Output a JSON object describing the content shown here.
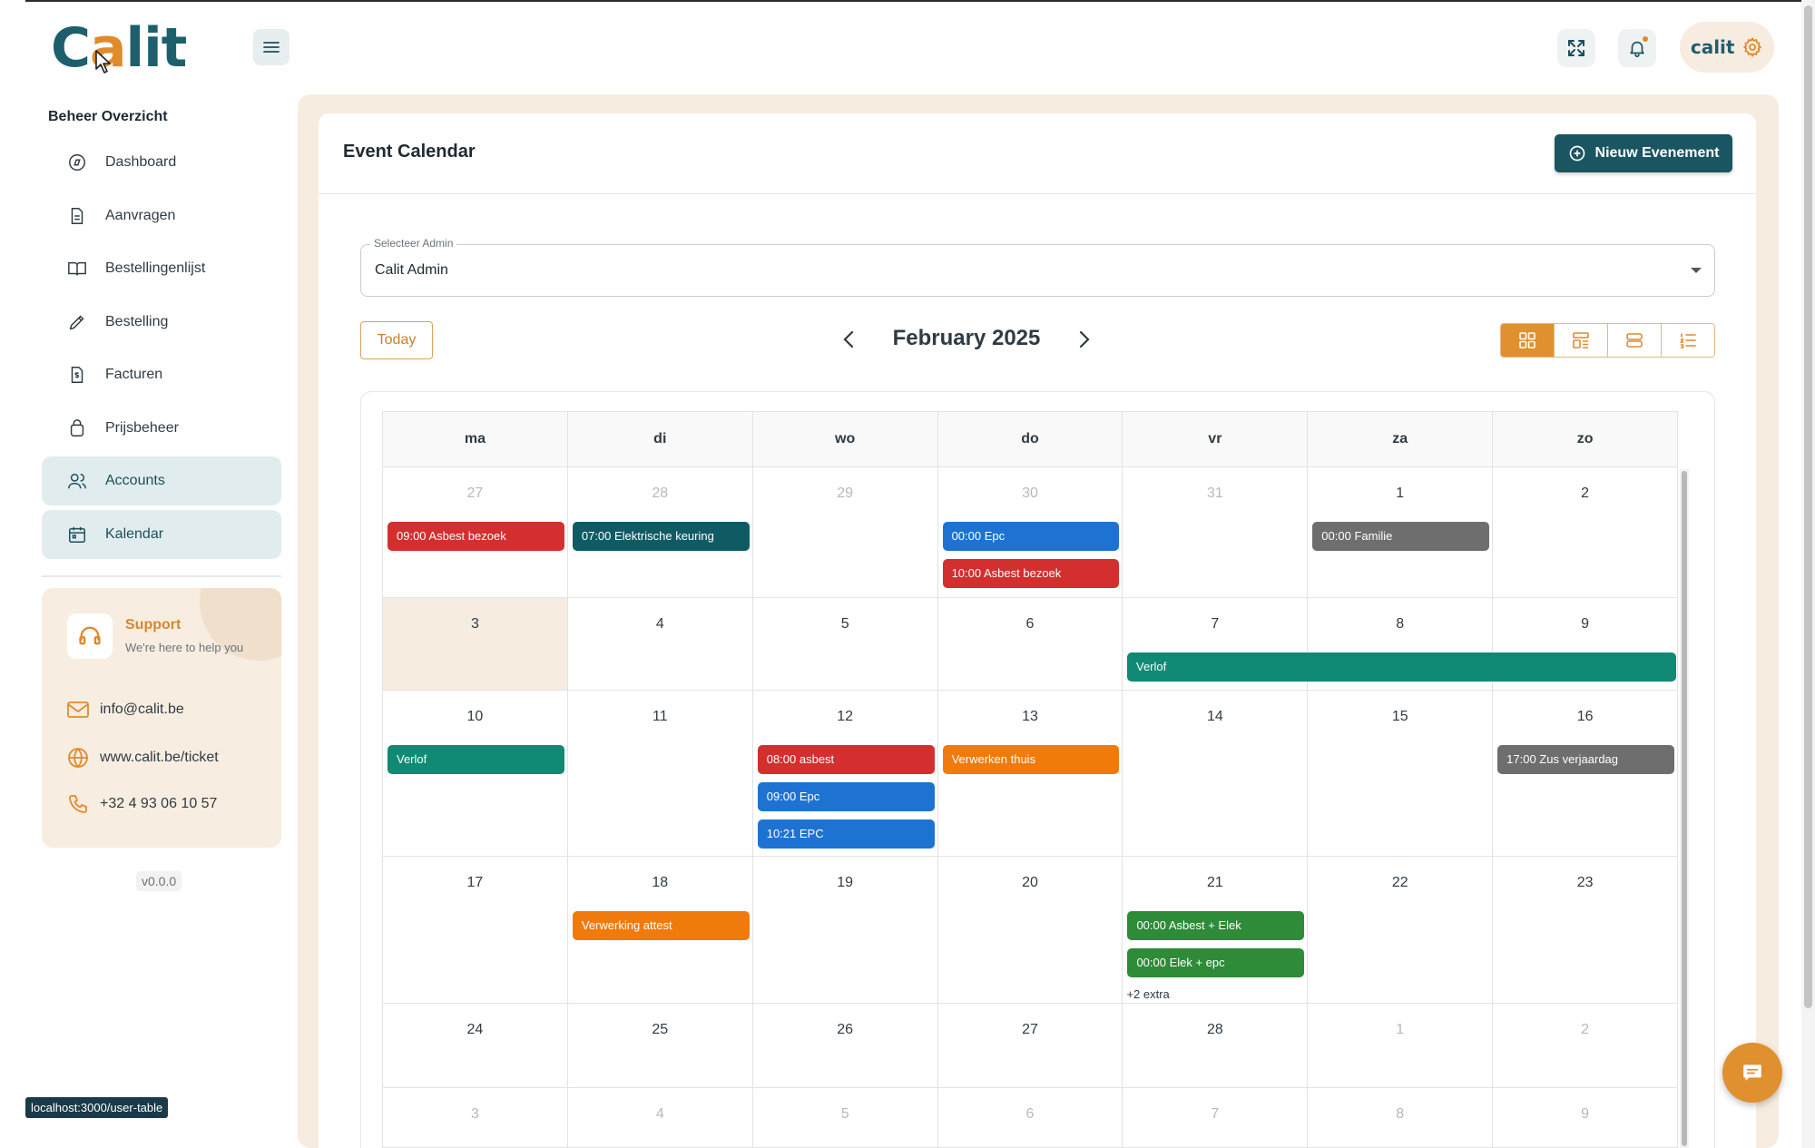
{
  "app": {
    "logo_main": "Calit",
    "logo_part1": "C",
    "logo_accent": "a",
    "logo_part2": "lit",
    "profile_mini": "calit"
  },
  "sidebar": {
    "section_title": "Beheer Overzicht",
    "items": [
      {
        "label": "Dashboard",
        "icon": "compass-icon",
        "active": false
      },
      {
        "label": "Aanvragen",
        "icon": "document-icon",
        "active": false
      },
      {
        "label": "Bestellingenlijst",
        "icon": "book-icon",
        "active": false
      },
      {
        "label": "Bestelling",
        "icon": "pencil-icon",
        "active": false
      },
      {
        "label": "Facturen",
        "icon": "invoice-icon",
        "active": false
      },
      {
        "label": "Prijsbeheer",
        "icon": "bag-icon",
        "active": false
      },
      {
        "label": "Accounts",
        "icon": "users-icon",
        "active": true
      },
      {
        "label": "Kalendar",
        "icon": "calendar-icon",
        "active": true
      }
    ],
    "support": {
      "title": "Support",
      "subtitle": "We're here to help you",
      "email": "info@calit.be",
      "website": "www.calit.be/ticket",
      "phone": "+32 4 93 06 10 57"
    },
    "version": "v0.0.0"
  },
  "main": {
    "title": "Event Calendar",
    "new_button": "Nieuw Evenement",
    "admin_select": {
      "label": "Selecteer Admin",
      "value": "Calit Admin"
    },
    "today_button": "Today",
    "month_label": "February 2025",
    "weekdays": [
      "ma",
      "di",
      "wo",
      "do",
      "vr",
      "za",
      "zo"
    ],
    "weeks": [
      {
        "days": [
          {
            "num": "27",
            "dim": true,
            "events": [
              {
                "text": "09:00 Asbest bezoek",
                "color": "red"
              }
            ]
          },
          {
            "num": "28",
            "dim": true,
            "events": [
              {
                "text": "07:00 Elektrische keuring",
                "color": "teal"
              }
            ]
          },
          {
            "num": "29",
            "dim": true,
            "events": []
          },
          {
            "num": "30",
            "dim": true,
            "events": [
              {
                "text": "00:00 Epc",
                "color": "blue"
              },
              {
                "text": "10:00 Asbest bezoek",
                "color": "red"
              }
            ]
          },
          {
            "num": "31",
            "dim": true,
            "events": []
          },
          {
            "num": "1",
            "dim": false,
            "events": [
              {
                "text": "00:00 Familie",
                "color": "gray"
              }
            ]
          },
          {
            "num": "2",
            "dim": false,
            "events": []
          }
        ]
      },
      {
        "days": [
          {
            "num": "3",
            "dim": false,
            "events": []
          },
          {
            "num": "4",
            "dim": false,
            "events": []
          },
          {
            "num": "5",
            "dim": false,
            "events": []
          },
          {
            "num": "6",
            "dim": false,
            "events": []
          },
          {
            "num": "7",
            "dim": false,
            "events": []
          },
          {
            "num": "8",
            "dim": false,
            "events": []
          },
          {
            "num": "9",
            "dim": false,
            "events": []
          }
        ],
        "span_event": {
          "text": "Verlof",
          "color": "green"
        }
      },
      {
        "days": [
          {
            "num": "10",
            "dim": false,
            "events": [
              {
                "text": "Verlof",
                "color": "green"
              }
            ]
          },
          {
            "num": "11",
            "dim": false,
            "events": []
          },
          {
            "num": "12",
            "dim": false,
            "events": [
              {
                "text": "08:00 asbest",
                "color": "red"
              },
              {
                "text": "09:00 Epc",
                "color": "blue"
              },
              {
                "text": "10:21 EPC",
                "color": "blue"
              }
            ]
          },
          {
            "num": "13",
            "dim": false,
            "events": [
              {
                "text": "Verwerken thuis",
                "color": "orange"
              }
            ]
          },
          {
            "num": "14",
            "dim": false,
            "events": []
          },
          {
            "num": "15",
            "dim": false,
            "events": []
          },
          {
            "num": "16",
            "dim": false,
            "events": [
              {
                "text": "17:00 Zus verjaardag",
                "color": "gray"
              }
            ]
          }
        ]
      },
      {
        "days": [
          {
            "num": "17",
            "dim": false,
            "events": []
          },
          {
            "num": "18",
            "dim": false,
            "events": [
              {
                "text": "Verwerking attest",
                "color": "orange"
              }
            ]
          },
          {
            "num": "19",
            "dim": false,
            "events": []
          },
          {
            "num": "20",
            "dim": false,
            "events": []
          },
          {
            "num": "21",
            "dim": false,
            "events": [
              {
                "text": "00:00 Asbest + Elek",
                "color": "dgreen"
              },
              {
                "text": "00:00 Elek + epc",
                "color": "dgreen"
              }
            ],
            "extra": "+2 extra"
          },
          {
            "num": "22",
            "dim": false,
            "events": []
          },
          {
            "num": "23",
            "dim": false,
            "events": []
          }
        ]
      },
      {
        "days": [
          {
            "num": "24",
            "dim": false,
            "events": []
          },
          {
            "num": "25",
            "dim": false,
            "events": []
          },
          {
            "num": "26",
            "dim": false,
            "events": []
          },
          {
            "num": "27",
            "dim": false,
            "events": []
          },
          {
            "num": "28",
            "dim": false,
            "events": []
          },
          {
            "num": "1",
            "dim": true,
            "events": []
          },
          {
            "num": "2",
            "dim": true,
            "events": []
          }
        ]
      },
      {
        "days": [
          {
            "num": "3",
            "dim": true,
            "events": []
          },
          {
            "num": "4",
            "dim": true,
            "events": []
          },
          {
            "num": "5",
            "dim": true,
            "events": []
          },
          {
            "num": "6",
            "dim": true,
            "events": []
          },
          {
            "num": "7",
            "dim": true,
            "events": []
          },
          {
            "num": "8",
            "dim": true,
            "events": []
          },
          {
            "num": "9",
            "dim": true,
            "events": []
          }
        ]
      }
    ]
  },
  "status_bar": {
    "url": "localhost:3000/user-table"
  },
  "colors": {
    "brand_dark": "#1a5561",
    "accent_orange": "#e1902f",
    "event_red": "#d32f2f",
    "event_teal": "#0f5b63",
    "event_blue": "#1e73d2",
    "event_gray": "#6e6e6e",
    "event_green": "#108a74",
    "event_dgreen": "#2e8b37",
    "event_orange": "#f07b0c"
  }
}
